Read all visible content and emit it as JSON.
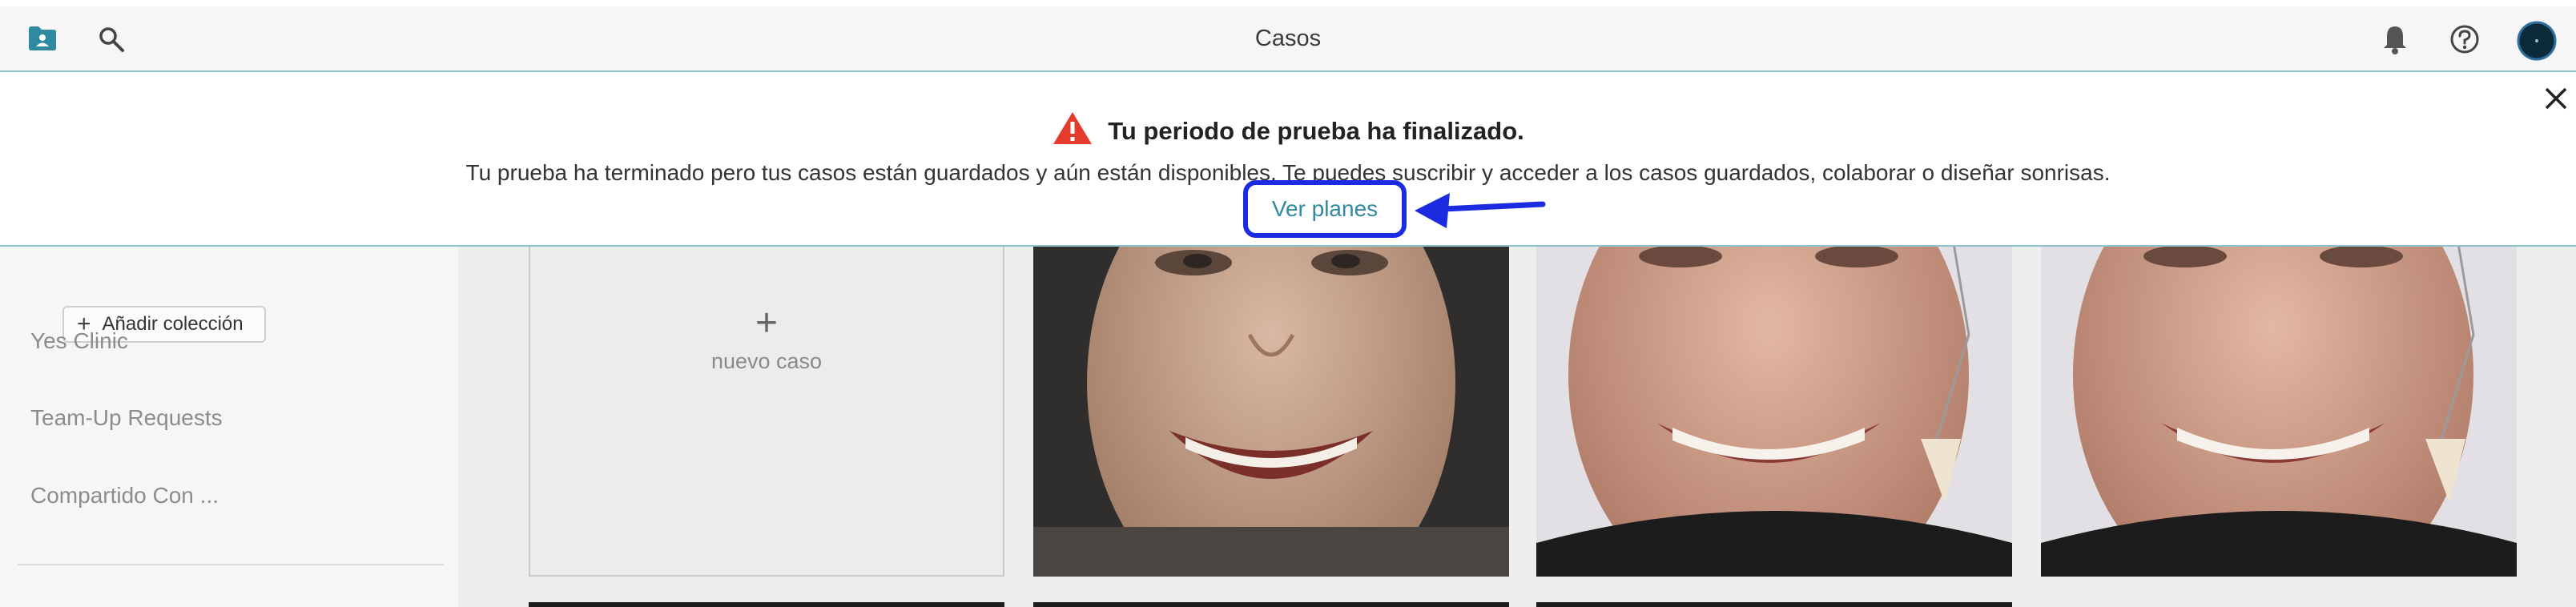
{
  "header": {
    "title": "Casos",
    "icons": [
      "cases-folder-icon",
      "search-icon",
      "bell-icon",
      "help-icon",
      "avatar"
    ]
  },
  "banner": {
    "heading": "Tu periodo de prueba ha finalizado.",
    "message": "Tu prueba ha terminado pero tus casos están guardados y aún están disponibles. Te puedes suscribir y acceder a los casos guardados, colaborar o diseñar sonrisas.",
    "action_label": "Ver planes",
    "warning_color": "#e43b2c",
    "highlight_color": "#1a2be0"
  },
  "sidebar": {
    "add_collection_label": "Añadir colección",
    "items": [
      {
        "label": "Yes Clinic"
      },
      {
        "label": "Team-Up Requests"
      },
      {
        "label": "Compartido Con ..."
      }
    ]
  },
  "main": {
    "new_case_plus": "+",
    "new_case_label": "nuevo caso",
    "cases": [
      {
        "name": "case-photo-1"
      },
      {
        "name": "case-photo-2"
      },
      {
        "name": "case-photo-3"
      }
    ]
  },
  "colors": {
    "accent": "#2f8aa0",
    "topbar_border": "#8fc3c9"
  }
}
